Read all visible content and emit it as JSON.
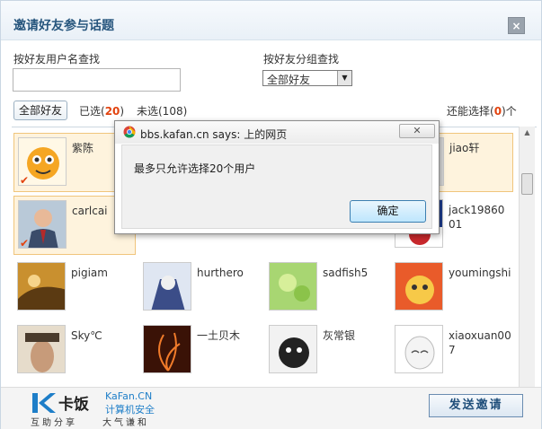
{
  "dialog": {
    "title": "邀请好友参与话题",
    "close_icon": "×"
  },
  "search": {
    "by_name_label": "按好友用户名查找",
    "name_value": "",
    "by_group_label": "按好友分组查找",
    "group_selected": "全部好友"
  },
  "tabs": {
    "all_label": "全部好友",
    "selected_prefix": "已选(",
    "selected_count": "20",
    "selected_suffix": ")",
    "unselected": "未选(108)",
    "remaining_prefix": "还能选择(",
    "remaining_count": "0",
    "remaining_suffix": ")个"
  },
  "friends": [
    {
      "name": "紫陈",
      "selected": true
    },
    {
      "name": "jiao轩",
      "selected": true
    },
    {
      "name": "carlcai",
      "selected": true
    },
    {
      "name": "jack1986001",
      "selected": false
    },
    {
      "name": "pigiam",
      "selected": false
    },
    {
      "name": "hurthero",
      "selected": false
    },
    {
      "name": "sadfish5",
      "selected": false
    },
    {
      "name": "youmingshi",
      "selected": false
    },
    {
      "name": "Sky℃",
      "selected": false
    },
    {
      "name": "一土贝木",
      "selected": false
    },
    {
      "name": "灰常银",
      "selected": false
    },
    {
      "name": "xiaoxuan007",
      "selected": false
    }
  ],
  "check_mark": "✔",
  "footer": {
    "logo_cn": "卡饭",
    "logo_en": "KaFan.CN",
    "logo_sec": "计算机安全",
    "logo_sub1": "互助分享",
    "logo_sub2": "大气谦和",
    "send_label": "发送邀请"
  },
  "alert": {
    "title": "bbs.kafan.cn says: 上的网页",
    "message": "最多只允许选择20个用户",
    "ok_label": "确定",
    "close_icon": "✕"
  },
  "colors": {
    "accent_red": "#e2430f",
    "title_blue": "#26557d",
    "selected_bg": "#fef3dd"
  }
}
